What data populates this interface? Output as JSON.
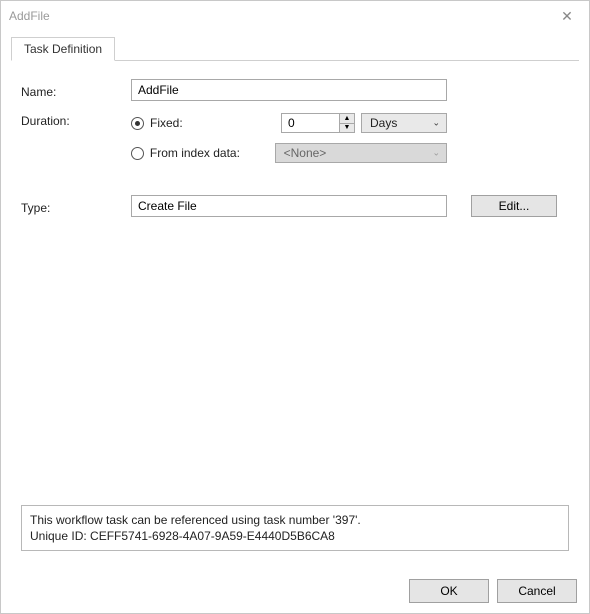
{
  "window": {
    "title": "AddFile"
  },
  "tab": {
    "label": "Task Definition"
  },
  "labels": {
    "name": "Name:",
    "duration": "Duration:",
    "type": "Type:",
    "fixed": "Fixed:",
    "from_index": "From index data:"
  },
  "fields": {
    "name_value": "AddFile",
    "fixed_value": "0",
    "unit_selected": "Days",
    "from_index_selected": "<None>",
    "type_value": "Create File"
  },
  "buttons": {
    "edit": "Edit...",
    "ok": "OK",
    "cancel": "Cancel"
  },
  "reference": {
    "line1": "This workflow task can be referenced using task number '397'.",
    "line2": "Unique ID: CEFF5741-6928-4A07-9A59-E4440D5B6CA8"
  },
  "glyphs": {
    "close": "✕",
    "up": "▲",
    "down": "▼",
    "chev": "⌄"
  }
}
